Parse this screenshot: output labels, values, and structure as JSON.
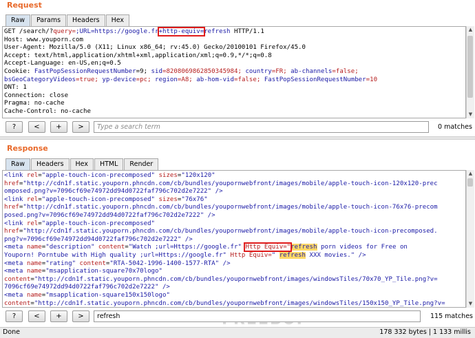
{
  "request": {
    "title": "Request",
    "tabs": [
      "Raw",
      "Params",
      "Headers",
      "Hex"
    ],
    "lines": {
      "l1a": "GET /search/?",
      "l1b": "query=",
      "l1c": ";URL=https://google.fr",
      "l1d": "+http-equiv=",
      "l1e": "refresh",
      "l1f": " HTTP/1.1",
      "l2": "Host: www.youporn.com",
      "l3": "User-Agent: Mozilla/5.0 (X11; Linux x86_64; rv:45.0) Gecko/20100101 Firefox/45.0",
      "l4": "Accept: text/html,application/xhtml+xml,application/xml;q=0.9,*/*;q=0.8",
      "l5": "Accept-Language: en-US,en;q=0.5",
      "l6a": "Cookie: ",
      "l6b": "FastPopSessionRequestNumber",
      "l6c": "=9; ",
      "l6d": "sid",
      "l6e": "=8208069862850345984; ",
      "l6f": "country",
      "l6g": "=FR; ",
      "l6h": "ab-channels",
      "l6i": "=false;",
      "l7a": "bsGeoCategoryVideos",
      "l7b": "=true; ",
      "l7c": "yp-device",
      "l7d": "=pc; ",
      "l7e": "region",
      "l7f": "=A8; ",
      "l7g": "ab-hom-vid",
      "l7h": "=false; ",
      "l7i": "FastPopSessionRequestNumber",
      "l7j": "=10",
      "l8": "DNT: 1",
      "l9": "Connection: close",
      "l10": "Pragma: no-cache",
      "l11": "Cache-Control: no-cache"
    },
    "search": {
      "help": "?",
      "prev": "<",
      "next": "+",
      "forward": ">",
      "placeholder": "Type a search term",
      "matches": "0 matches"
    }
  },
  "response": {
    "title": "Response",
    "tabs": [
      "Raw",
      "Headers",
      "Hex",
      "HTML",
      "Render"
    ],
    "lines": {
      "r1a": "<link ",
      "r1b": "rel",
      "r1c": "=",
      "r1d": "\"apple-touch-icon-precomposed\"",
      "r1e": " sizes",
      "r1f": "=",
      "r1g": "\"120x120\"",
      "r2a": "href",
      "r2b": "=",
      "r2c": "\"http://cdn1f.static.youporn.phncdn.com/cb/bundles/youpornwebfront/images/mobile/apple-touch-icon-120x120-prec",
      "r3a": "omposed.png?v=7096cf69e74972dd94d0722faf796c702d2e7222\"",
      "r3b": " />",
      "r4a": "<link ",
      "r4b": "rel",
      "r4c": "=",
      "r4d": "\"apple-touch-icon-precomposed\"",
      "r4e": " sizes",
      "r4f": "=",
      "r4g": "\"76x76\"",
      "r5a": "href",
      "r5b": "=",
      "r5c": "\"http://cdn1f.static.youporn.phncdn.com/cb/bundles/youpornwebfront/images/mobile/apple-touch-icon-76x76-precom",
      "r6a": "posed.png?v=7096cf69e74972dd94d0722faf796c702d2e7222\"",
      "r6b": " />",
      "r7a": "<link ",
      "r7b": "rel",
      "r7c": "=",
      "r7d": "\"apple-touch-icon-precomposed\"",
      "r8a": "href",
      "r8b": "=",
      "r8c": "\"http://cdn1f.static.youporn.phncdn.com/cb/bundles/youpornwebfront/images/mobile/apple-touch-icon-precomposed.",
      "r9a": "png?v=7096cf69e74972dd94d0722faf796c702d2e7222\"",
      "r9b": " />",
      "r10a": "<meta ",
      "r10b": "name",
      "r10c": "=",
      "r10d": "\"description\"",
      "r10e": " content",
      "r10f": "=",
      "r10g": "\"Watch ;url=Https://google.fr\"",
      "r10h": " ",
      "r10i": "Http Equiv=\"",
      "r10j": "refresh",
      "r10k": " porn videos for Free on",
      "r11a": "Youporn! Porntube with High quality ;url=Https://google.fr\" ",
      "r11b": "Http Equiv=",
      "r11c": "\" ",
      "r11d": "refresh",
      "r11e": " XXX movies.\"",
      "r11f": " />",
      "r12a": "<meta ",
      "r12b": "name",
      "r12c": "=",
      "r12d": "\"rating\"",
      "r12e": " content",
      "r12f": "=",
      "r12g": "\"RTA-5042-1996-1400-1577-RTA\"",
      "r12h": " />",
      "r13a": "<meta ",
      "r13b": "name",
      "r13c": "=",
      "r13d": "\"msapplication-square70x70logo\"",
      "r14a": "content",
      "r14b": "=",
      "r14c": "\"http://cdn1f.static.youporn.phncdn.com/cb/bundles/youpornwebfront/images/windowsTiles/70x70_YP_Tile.png?v=",
      "r15a": "7096cf69e74972dd94d0722faf796c702d2e7222\"",
      "r15b": " />",
      "r16a": "<meta ",
      "r16b": "name",
      "r16c": "=",
      "r16d": "\"msapplication-square150x150logo\"",
      "r17a": "content",
      "r17b": "=",
      "r17c": "\"http://cdn1f.static.youporn.phncdn.com/cb/bundles/youpornwebfront/images/windowsTiles/150x150_YP_Tile.png?v="
    },
    "search": {
      "help": "?",
      "prev": "<",
      "next": "+",
      "forward": ">",
      "value": "refresh",
      "matches": "115 matches"
    }
  },
  "status": {
    "left": "Done",
    "right": "178 332 bytes | 1 133 millis"
  },
  "watermark": "FREEBUF",
  "colors": {
    "accent": "#e8692a",
    "highlight": "#ffd966",
    "box": "#e01b1b"
  }
}
